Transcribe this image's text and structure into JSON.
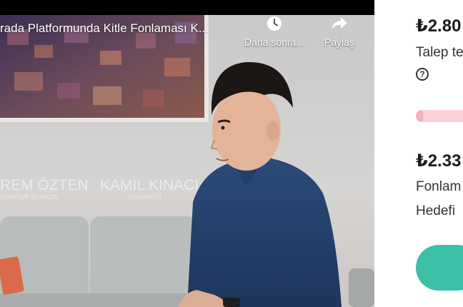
{
  "video": {
    "title": "rada Platformunda Kitle Fonlaması K...",
    "watch_later_label": "Daha sonra...",
    "share_label": "Paylaş",
    "lower_thirds": [
      {
        "name": "REM ÖZTEN",
        "role": "STARTUP BURADA"
      },
      {
        "name": "KAMİL KINACI",
        "role": "EGARANTİ"
      }
    ],
    "icons": {
      "watch_later": "clock-icon",
      "share": "share-arrow-icon"
    }
  },
  "panel": {
    "amount_1": "₺2.80",
    "text_1": "Talep te",
    "help_symbol": "?",
    "progress_fraction": 0.12,
    "amount_2": "₺2.33",
    "text_2": "Fonlam",
    "text_3": "Hedefi",
    "cta_color": "#3bbfa6",
    "progress_color": "#f9d0d6"
  }
}
